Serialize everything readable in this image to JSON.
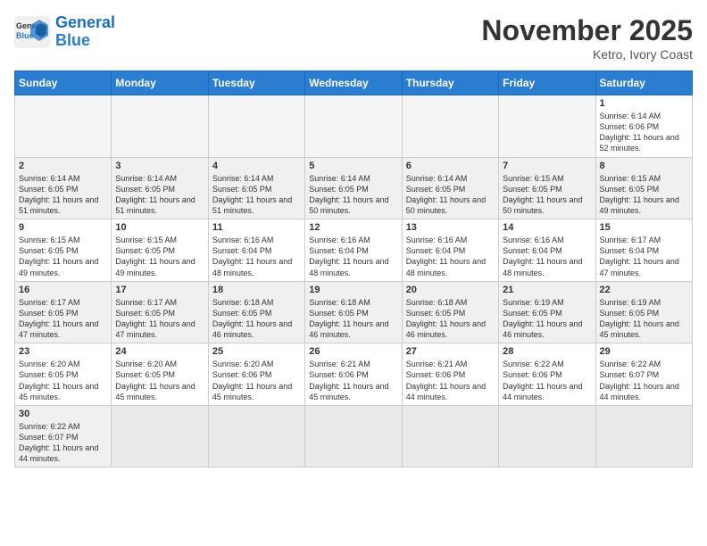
{
  "header": {
    "logo_general": "General",
    "logo_blue": "Blue",
    "month_title": "November 2025",
    "location": "Ketro, Ivory Coast"
  },
  "weekdays": [
    "Sunday",
    "Monday",
    "Tuesday",
    "Wednesday",
    "Thursday",
    "Friday",
    "Saturday"
  ],
  "weeks": [
    [
      {
        "day": "",
        "empty": true
      },
      {
        "day": "",
        "empty": true
      },
      {
        "day": "",
        "empty": true
      },
      {
        "day": "",
        "empty": true
      },
      {
        "day": "",
        "empty": true
      },
      {
        "day": "",
        "empty": true
      },
      {
        "day": "1",
        "sunrise": "6:14 AM",
        "sunset": "6:06 PM",
        "daylight": "11 hours and 52 minutes."
      }
    ],
    [
      {
        "day": "2",
        "sunrise": "6:14 AM",
        "sunset": "6:05 PM",
        "daylight": "11 hours and 51 minutes."
      },
      {
        "day": "3",
        "sunrise": "6:14 AM",
        "sunset": "6:05 PM",
        "daylight": "11 hours and 51 minutes."
      },
      {
        "day": "4",
        "sunrise": "6:14 AM",
        "sunset": "6:05 PM",
        "daylight": "11 hours and 51 minutes."
      },
      {
        "day": "5",
        "sunrise": "6:14 AM",
        "sunset": "6:05 PM",
        "daylight": "11 hours and 50 minutes."
      },
      {
        "day": "6",
        "sunrise": "6:14 AM",
        "sunset": "6:05 PM",
        "daylight": "11 hours and 50 minutes."
      },
      {
        "day": "7",
        "sunrise": "6:15 AM",
        "sunset": "6:05 PM",
        "daylight": "11 hours and 50 minutes."
      },
      {
        "day": "8",
        "sunrise": "6:15 AM",
        "sunset": "6:05 PM",
        "daylight": "11 hours and 49 minutes."
      }
    ],
    [
      {
        "day": "9",
        "sunrise": "6:15 AM",
        "sunset": "6:05 PM",
        "daylight": "11 hours and 49 minutes."
      },
      {
        "day": "10",
        "sunrise": "6:15 AM",
        "sunset": "6:05 PM",
        "daylight": "11 hours and 49 minutes."
      },
      {
        "day": "11",
        "sunrise": "6:16 AM",
        "sunset": "6:04 PM",
        "daylight": "11 hours and 48 minutes."
      },
      {
        "day": "12",
        "sunrise": "6:16 AM",
        "sunset": "6:04 PM",
        "daylight": "11 hours and 48 minutes."
      },
      {
        "day": "13",
        "sunrise": "6:16 AM",
        "sunset": "6:04 PM",
        "daylight": "11 hours and 48 minutes."
      },
      {
        "day": "14",
        "sunrise": "6:16 AM",
        "sunset": "6:04 PM",
        "daylight": "11 hours and 48 minutes."
      },
      {
        "day": "15",
        "sunrise": "6:17 AM",
        "sunset": "6:04 PM",
        "daylight": "11 hours and 47 minutes."
      }
    ],
    [
      {
        "day": "16",
        "sunrise": "6:17 AM",
        "sunset": "6:05 PM",
        "daylight": "11 hours and 47 minutes."
      },
      {
        "day": "17",
        "sunrise": "6:17 AM",
        "sunset": "6:05 PM",
        "daylight": "11 hours and 47 minutes."
      },
      {
        "day": "18",
        "sunrise": "6:18 AM",
        "sunset": "6:05 PM",
        "daylight": "11 hours and 46 minutes."
      },
      {
        "day": "19",
        "sunrise": "6:18 AM",
        "sunset": "6:05 PM",
        "daylight": "11 hours and 46 minutes."
      },
      {
        "day": "20",
        "sunrise": "6:18 AM",
        "sunset": "6:05 PM",
        "daylight": "11 hours and 46 minutes."
      },
      {
        "day": "21",
        "sunrise": "6:19 AM",
        "sunset": "6:05 PM",
        "daylight": "11 hours and 46 minutes."
      },
      {
        "day": "22",
        "sunrise": "6:19 AM",
        "sunset": "6:05 PM",
        "daylight": "11 hours and 45 minutes."
      }
    ],
    [
      {
        "day": "23",
        "sunrise": "6:20 AM",
        "sunset": "6:05 PM",
        "daylight": "11 hours and 45 minutes."
      },
      {
        "day": "24",
        "sunrise": "6:20 AM",
        "sunset": "6:05 PM",
        "daylight": "11 hours and 45 minutes."
      },
      {
        "day": "25",
        "sunrise": "6:20 AM",
        "sunset": "6:06 PM",
        "daylight": "11 hours and 45 minutes."
      },
      {
        "day": "26",
        "sunrise": "6:21 AM",
        "sunset": "6:06 PM",
        "daylight": "11 hours and 45 minutes."
      },
      {
        "day": "27",
        "sunrise": "6:21 AM",
        "sunset": "6:06 PM",
        "daylight": "11 hours and 44 minutes."
      },
      {
        "day": "28",
        "sunrise": "6:22 AM",
        "sunset": "6:06 PM",
        "daylight": "11 hours and 44 minutes."
      },
      {
        "day": "29",
        "sunrise": "6:22 AM",
        "sunset": "6:07 PM",
        "daylight": "11 hours and 44 minutes."
      }
    ],
    [
      {
        "day": "30",
        "sunrise": "6:22 AM",
        "sunset": "6:07 PM",
        "daylight": "11 hours and 44 minutes."
      },
      {
        "day": "",
        "empty": true
      },
      {
        "day": "",
        "empty": true
      },
      {
        "day": "",
        "empty": true
      },
      {
        "day": "",
        "empty": true
      },
      {
        "day": "",
        "empty": true
      },
      {
        "day": "",
        "empty": true
      }
    ]
  ],
  "labels": {
    "sunrise": "Sunrise:",
    "sunset": "Sunset:",
    "daylight": "Daylight:"
  }
}
